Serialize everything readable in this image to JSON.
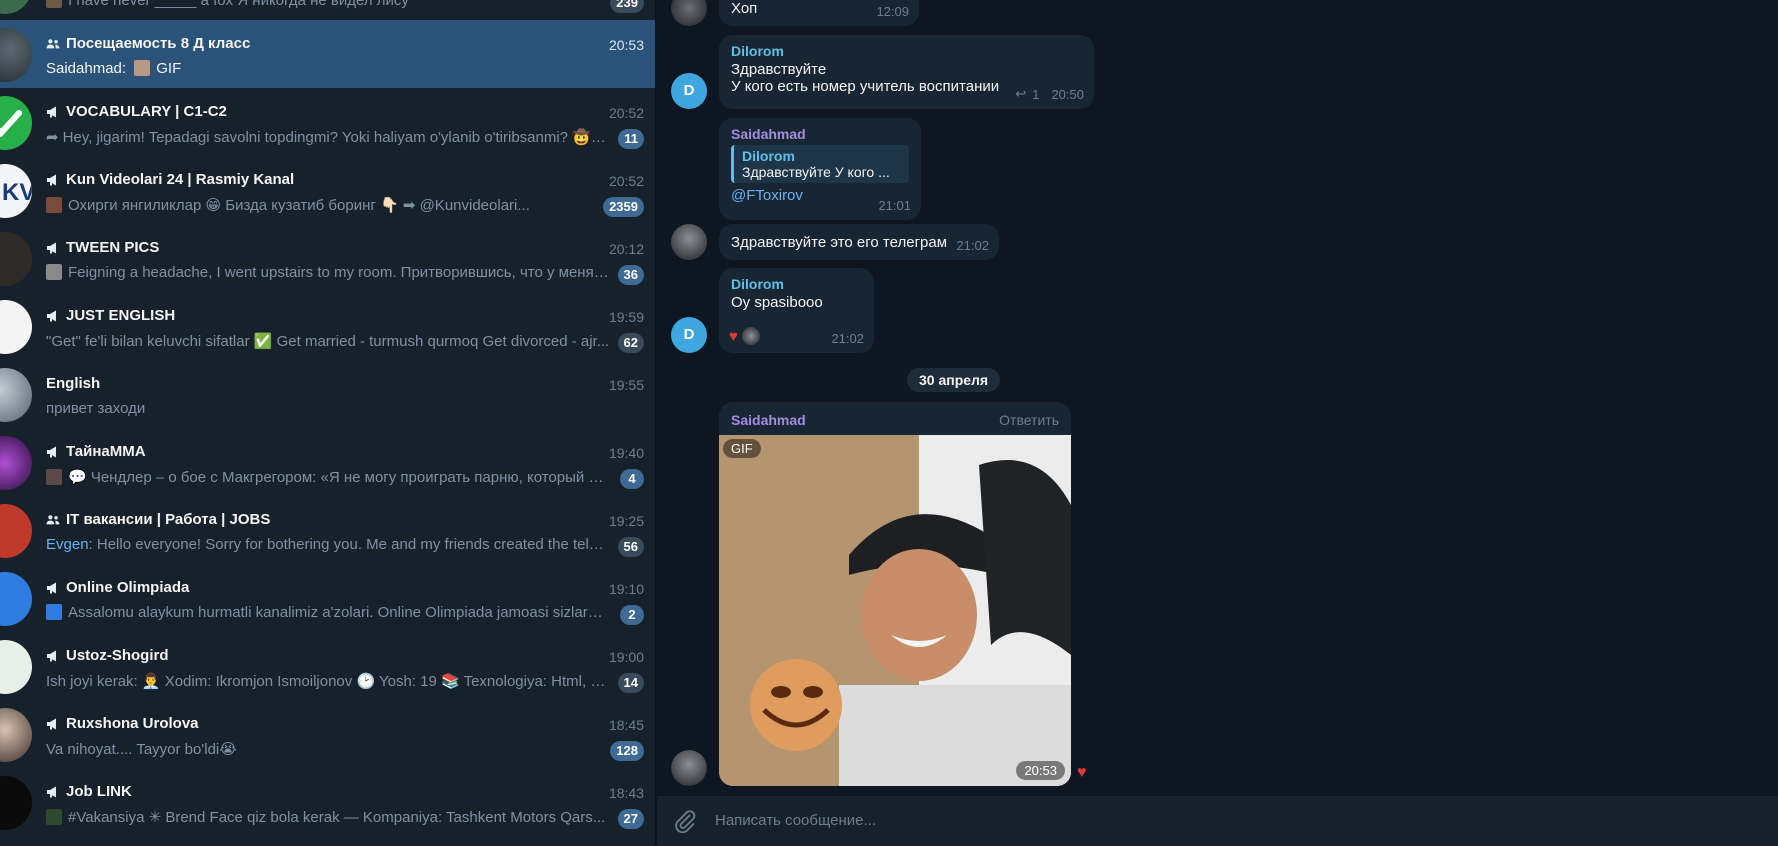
{
  "chat_list": {
    "partial_top_preview": "I have never _____ a fox  Я никогда не видел лису",
    "partial_top_badge": "239",
    "chats": [
      {
        "title": "Посещаемость 8 Д класс",
        "kind": "group-icon",
        "time": "20:53",
        "author": "Saidahmad:",
        "preview": "GIF",
        "badge": "",
        "selected": true
      },
      {
        "title": "VOCABULARY | C1-C2",
        "kind": "channel-icon",
        "time": "20:52",
        "author": "",
        "preview": "Hey, jigarim! Tepadagi savolni topdingmi? Yoki haliyam o'ylanib o'tiribsanmi? 🤠 🤠",
        "badge": "11",
        "selected": false
      },
      {
        "title": "Kun Videolari 24 | Rasmiy Kanal",
        "kind": "channel-icon",
        "time": "20:52",
        "author": "",
        "preview": "Охирги янгиликлар 😁  Бизда кузатиб боринг 👇🏻                    ➡ @Kunvideolari...",
        "badge": "2359",
        "selected": false
      },
      {
        "title": "TWEEN PICS",
        "kind": "channel-icon",
        "time": "20:12",
        "author": "",
        "preview": "Feigning a headache, I went upstairs to my room. Притворившись, что у меня б...",
        "badge": "36",
        "selected": false
      },
      {
        "title": "JUST ENGLISH",
        "kind": "channel-icon",
        "time": "19:59",
        "author": "",
        "preview": "\"Get\" fe'li bilan keluvchi sifatlar ✅  Get married - turmush qurmoq Get divorced - ajr...",
        "badge": "62",
        "selected": false
      },
      {
        "title": "English",
        "kind": "",
        "time": "19:55",
        "author": "",
        "preview": "привет заходи",
        "badge": "",
        "selected": false
      },
      {
        "title": "ТайнаММА",
        "kind": "channel-icon",
        "time": "19:40",
        "author": "",
        "preview": "💬 Чендлер – о бое с Макгрегором: «Я не могу проиграть парню, который отс...",
        "badge": "4",
        "selected": false
      },
      {
        "title": "IT вакансии | Работа | JOBS",
        "kind": "group-icon",
        "time": "19:25",
        "author": "Evgen:",
        "preview": "Hello everyone! Sorry for bothering you. Me and my friends created the telegr...",
        "badge": "56",
        "selected": false
      },
      {
        "title": "Online Olimpiada",
        "kind": "channel-icon",
        "time": "19:10",
        "author": "",
        "preview": "Assalomu alaykum hurmatli kanalimiz a'zolari.  Online Olimpiada jamoasi sizlarga ...",
        "badge": "2",
        "selected": false
      },
      {
        "title": "Ustoz-Shogird",
        "kind": "channel-icon",
        "time": "19:00",
        "author": "",
        "preview": "Ish joyi kerak:  👨‍💼 Xodim: Ikromjon Ismoiljonov 🕑 Yosh: 19 📚 Texnologiya: Html, C...",
        "badge": "14",
        "selected": false
      },
      {
        "title": "Ruxshona Urolova",
        "kind": "channel-icon",
        "time": "18:45",
        "author": "",
        "preview": "Va nihoyat.... Tayyor bo'ldi😭",
        "badge": "128",
        "selected": false
      },
      {
        "title": "Job LINK",
        "kind": "channel-icon",
        "time": "18:43",
        "author": "",
        "preview": "#Vakansiya  ✳ Brend Face qiz bola kerak  — Kompaniya: Tashkent Motors Qars...",
        "badge": "27",
        "selected": false
      }
    ]
  },
  "conversation": {
    "msg_hop": {
      "text": "Хоп",
      "time": "12:09"
    },
    "msg_dilorom_1": {
      "sender": "Dilorom",
      "avatar_letter": "D",
      "line1": "Здравствуйте",
      "line2": "У кого есть номер учитель воспитании",
      "replies": "1",
      "time": "20:50"
    },
    "msg_saidahmad_reply": {
      "sender": "Saidahmad",
      "quote_author": "Dilorom",
      "quote_text": "Здравствуйте  У кого ...",
      "mention": "@FToxirov",
      "time": "21:01"
    },
    "msg_telegram": {
      "text": "Здравствуйте это его телеграм",
      "time": "21:02"
    },
    "msg_dilorom_2": {
      "sender": "Dilorom",
      "avatar_letter": "D",
      "text": "Oy spasibooo",
      "reaction": "♥",
      "time": "21:02"
    },
    "date_separator": "30 апреля",
    "msg_gif": {
      "sender": "Saidahmad",
      "reply_label": "Ответить",
      "gif_label": "GIF",
      "time": "20:53",
      "reaction": "♥"
    },
    "input_placeholder": "Написать сообщение..."
  },
  "colors": {
    "sidebar_bg": "#17212b",
    "selected": "#2b5278",
    "chat_bg": "#0e1621",
    "bubble": "#182533",
    "accent": "#6ab3f3",
    "badge": "#3e6a95"
  }
}
